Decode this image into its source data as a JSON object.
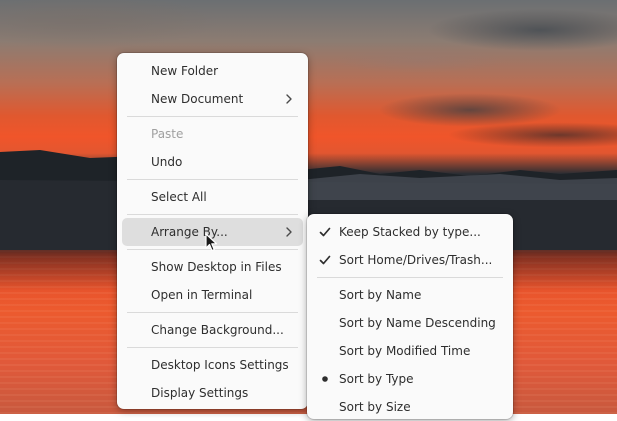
{
  "desktop": {
    "wallpaper": "sunset-lake"
  },
  "context_menu": {
    "items": [
      {
        "label": "New Folder"
      },
      {
        "label": "New Document",
        "submenu": true
      },
      {
        "label": "Paste",
        "disabled": true
      },
      {
        "label": "Undo"
      },
      {
        "label": "Select All"
      },
      {
        "label": "Arrange By...",
        "submenu": true,
        "highlighted": true
      },
      {
        "label": "Show Desktop in Files"
      },
      {
        "label": "Open in Terminal"
      },
      {
        "label": "Change Background..."
      },
      {
        "label": "Desktop Icons Settings"
      },
      {
        "label": "Display Settings"
      }
    ]
  },
  "arrange_submenu": {
    "items": [
      {
        "label": "Keep Stacked by type...",
        "mark": "check"
      },
      {
        "label": "Sort Home/Drives/Trash...",
        "mark": "check"
      },
      {
        "label": "Sort by Name"
      },
      {
        "label": "Sort by Name Descending"
      },
      {
        "label": "Sort by Modified Time"
      },
      {
        "label": "Sort by Type",
        "mark": "radio-dot"
      },
      {
        "label": "Sort by Size"
      }
    ]
  },
  "icons": {
    "submenu_arrow": "chevron-right-icon",
    "check": "checkmark-icon",
    "radio": "radio-dot-icon",
    "pointer": "mouse-pointer-icon"
  },
  "colors": {
    "menu_bg": "#fafafa",
    "hover_bg": "#dedede",
    "text": "#2e2e2e",
    "disabled_text": "#a0a0a0"
  }
}
